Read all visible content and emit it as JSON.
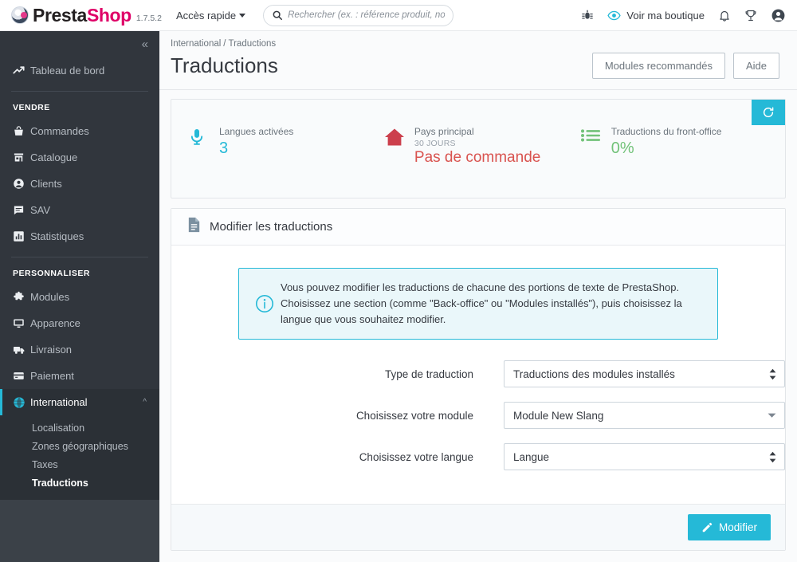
{
  "header": {
    "brand_a": "Presta",
    "brand_b": "Shop",
    "version": "1.7.5.2",
    "quick_access": "Accès rapide",
    "search_placeholder": "Rechercher (ex. : référence produit, nom",
    "search_value": "",
    "shop_view": "Voir ma boutique",
    "icons": [
      "bug-icon",
      "eye-icon",
      "bell-icon",
      "trophy-icon",
      "account-icon"
    ]
  },
  "sidebar": {
    "collapse_label": "«",
    "dashboard": "Tableau de bord",
    "group_sell": "VENDRE",
    "group_customize": "PERSONNALISER",
    "sell_items": [
      {
        "label": "Commandes",
        "icon": "basket-icon"
      },
      {
        "label": "Catalogue",
        "icon": "store-icon"
      },
      {
        "label": "Clients",
        "icon": "person-icon"
      },
      {
        "label": "SAV",
        "icon": "chat-icon"
      },
      {
        "label": "Statistiques",
        "icon": "bars-icon"
      }
    ],
    "customize_items": [
      {
        "label": "Modules",
        "icon": "puzzle-icon"
      },
      {
        "label": "Apparence",
        "icon": "monitor-icon"
      },
      {
        "label": "Livraison",
        "icon": "truck-icon"
      },
      {
        "label": "Paiement",
        "icon": "card-icon"
      },
      {
        "label": "International",
        "icon": "globe-icon"
      }
    ],
    "submenu": [
      "Localisation",
      "Zones géographiques",
      "Taxes",
      "Traductions"
    ],
    "current_sub": "Traductions"
  },
  "page": {
    "breadcrumb_parent": "International",
    "breadcrumb_current": "Traductions",
    "title": "Traductions",
    "btn_recommended": "Modules recommandés",
    "btn_help": "Aide"
  },
  "kpis": [
    {
      "label": "Langues activées",
      "sub": "",
      "value": "3",
      "tone": "teal",
      "icon": "microphone-icon"
    },
    {
      "label": "Pays principal",
      "sub": "30 JOURS",
      "value": "Pas de commande",
      "tone": "red",
      "icon": "home-icon"
    },
    {
      "label": "Traductions du front-office",
      "sub": "",
      "value": "0%",
      "tone": "green",
      "icon": "list-icon"
    }
  ],
  "kpi_refresh_icon": "refresh-icon",
  "card": {
    "title": "Modifier les traductions",
    "title_icon": "document-icon",
    "alert_icon": "info-icon",
    "alert_line1": "Vous pouvez modifier les traductions de chacune des portions de texte de PrestaShop.",
    "alert_line2": "Choisissez une section (comme \"Back-office\" ou \"Modules installés\"), puis choisissez la langue que vous souhaitez modifier.",
    "fields": [
      {
        "label": "Type de traduction",
        "value": "Traductions des modules installés",
        "control": "select"
      },
      {
        "label": "Choisissez votre module",
        "value": "Module New Slang",
        "control": "dropdown"
      },
      {
        "label": "Choisissez votre langue",
        "value": "Langue",
        "control": "select"
      }
    ],
    "submit_label": "Modifier",
    "submit_icon": "pencil-icon"
  },
  "colors": {
    "accent": "#25b9d7",
    "brand_pink": "#df0067",
    "danger": "#d9534f",
    "success": "#72c279",
    "sidebar": "#31363d"
  }
}
